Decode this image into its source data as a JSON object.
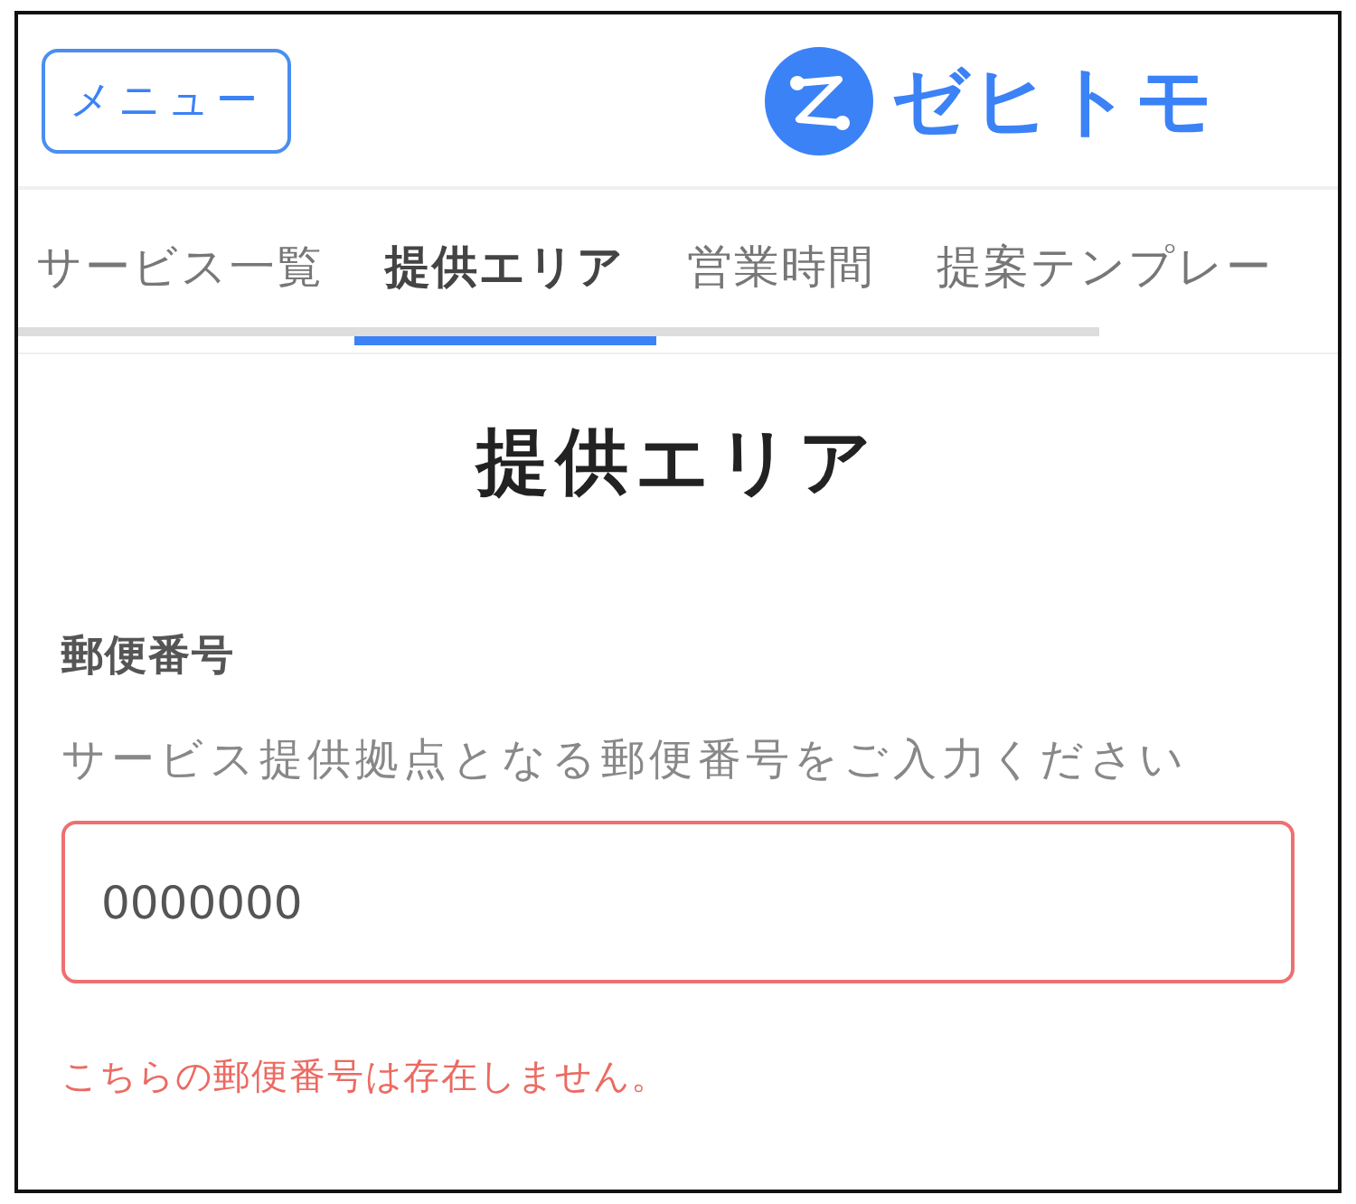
{
  "header": {
    "menu_button": "メニュー",
    "logo_text": "ゼヒトモ"
  },
  "tabs": [
    {
      "label": "サービス一覧",
      "selected": false
    },
    {
      "label": "提供エリア",
      "selected": true
    },
    {
      "label": "営業時間",
      "selected": false
    },
    {
      "label": "提案テンプレー",
      "selected": false
    }
  ],
  "page_title": "提供エリア",
  "postal_code": {
    "label": "郵便番号",
    "hint": "サービス提供拠点となる郵便番号をご入力ください",
    "value": "0000000",
    "error": true,
    "error_message": "こちらの郵便番号は存在しません。"
  }
}
